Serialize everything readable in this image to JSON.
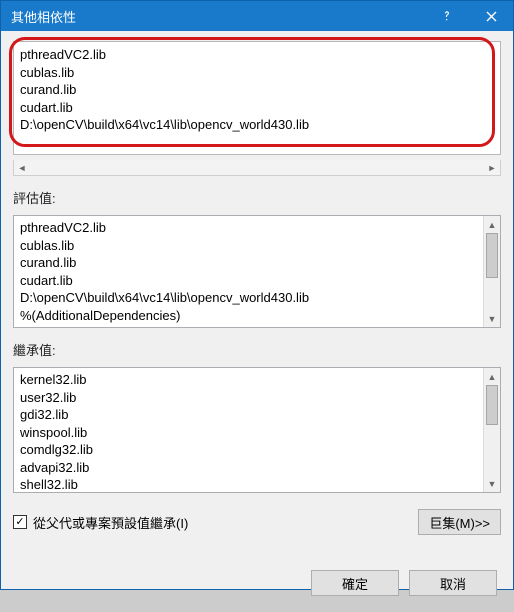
{
  "title": "其他相依性",
  "edit_lines": "pthreadVC2.lib\ncublas.lib\ncurand.lib\ncudart.lib\nD:\\openCV\\build\\x64\\vc14\\lib\\opencv_world430.lib",
  "labels": {
    "evaluated": "評估值:",
    "inherited": "繼承值:",
    "inherit_checkbox": "從父代或專案預設值繼承(I)"
  },
  "evaluated_lines": "pthreadVC2.lib\ncublas.lib\ncurand.lib\ncudart.lib\nD:\\openCV\\build\\x64\\vc14\\lib\\opencv_world430.lib\n%(AdditionalDependencies)",
  "inherited_lines": "kernel32.lib\nuser32.lib\ngdi32.lib\nwinspool.lib\ncomdlg32.lib\nadvapi32.lib\nshell32.lib",
  "inherit_checked": true,
  "buttons": {
    "macros": "巨集(M)>>",
    "ok": "確定",
    "cancel": "取消"
  }
}
